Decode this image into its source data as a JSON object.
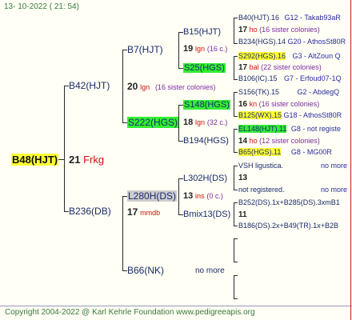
{
  "header": {
    "date_line": "13- 10-2022 ( 21: 54)"
  },
  "footer": {
    "copyright": "Copyright 2004-2022 @ Karl Kehrle Foundation   www.pedigreeapis.org"
  },
  "root": {
    "name": "B48(HJT)",
    "num": "21",
    "place": "Frkg"
  },
  "g1": [
    {
      "name": "B42(HJT)",
      "num": "20",
      "place": "lgn",
      "note": "(16 sister colonies)"
    },
    {
      "name": "B236(DB)",
      "num": "17",
      "place": "mmdb"
    }
  ],
  "g2": [
    {
      "name": "B7(HJT)",
      "num": "19",
      "place": "lgn",
      "note": "(16 c.)"
    },
    {
      "name": "S222(HGS)",
      "num": "18",
      "place": "lgn",
      "note": "(32 c.)"
    },
    {
      "name": "L280H(DS)",
      "num": "13",
      "place": "ins",
      "note": "(0 c.)"
    },
    {
      "name": "B66(NK)",
      "note": "no more"
    }
  ],
  "g3": [
    {
      "name": "B15(HJT)"
    },
    {
      "name": "S25(HGS)"
    },
    {
      "name": "S148(HGS)"
    },
    {
      "name": "B194(HGS)"
    },
    {
      "name": "L302H(DS)"
    },
    {
      "name": "Bmix13(DS)"
    }
  ],
  "g4": [
    {
      "line1": "B40(HJT).16",
      "line1b": "G12 - Takab93aR",
      "num": "17",
      "place": "ho",
      "note": "(16 sister colonies)",
      "line3": "B234(HGS).14",
      "line3b": "G20 - AthosSt80R"
    },
    {
      "line1": "S292(HGS).16",
      "line1b": "G3 - AltZoun Q",
      "num": "17",
      "place": "bal",
      "note": "(22 sister colonies)",
      "line3": "B106(IC).15",
      "line3b": "G7 - Erfoud07-1Q"
    },
    {
      "line1": "S156(TK).15",
      "line1b": "G2 - AbdegQ",
      "num": "16",
      "place": "kn",
      "note": "(16 sister colonies)",
      "line3": "B125(WX).15",
      "line3b": "G18 - AthosSt80R"
    },
    {
      "line1": "EL148(HJT).11",
      "line1b": "G8 - not registe",
      "num": "14",
      "place": "ho",
      "note": "(12 sister colonies)",
      "line3": "B65(HGS).11",
      "line3b": "G8 - MG00R"
    },
    {
      "line1": "VSH ligustica.",
      "line1b": "no more",
      "num": "13",
      "line3": "not registered.",
      "line3b": "no more"
    },
    {
      "line1": "B252(DS).1x+B285(DS).3xmB1",
      "num": "11",
      "line3": "B186(DS).2x+B49(TR).1x+B2B"
    }
  ],
  "colors": {
    "highlight_yellow": "#ffff33",
    "highlight_green": "#33ee33",
    "highlight_gray": "#cccccc",
    "place_red": "#cc1111",
    "note_purple": "#7a2aa0",
    "gen_blue": "#2a2aa0"
  }
}
